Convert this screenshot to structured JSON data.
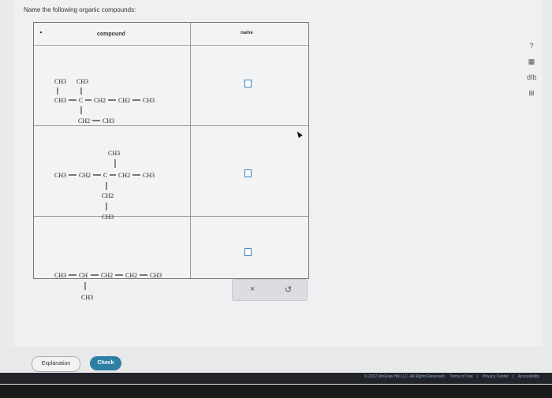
{
  "question": {
    "prompt": "Name the following organic compounds:"
  },
  "table": {
    "headers": {
      "compound": "compound",
      "name": "name"
    },
    "rows": [
      {
        "atoms": [
          "CH3",
          "CH3",
          "CH3",
          "C",
          "CH2",
          "CH2",
          "CH3",
          "CH2",
          "CH3"
        ]
      },
      {
        "atoms": [
          "CH3",
          "CH3",
          "CH2",
          "C",
          "CH2",
          "CH3",
          "CH2",
          "CH3"
        ]
      },
      {
        "atoms": [
          "CH3",
          "CH",
          "CH2",
          "CH2",
          "CH3",
          "CH3"
        ]
      }
    ]
  },
  "actions": {
    "clear": "×",
    "undo": "↺"
  },
  "sidebar_tools": {
    "help": "?",
    "periodic_table": "▦",
    "data": "dIb",
    "calculator": "⊞"
  },
  "buttons": {
    "explanation": "Explanation",
    "check": "Check"
  },
  "footer": {
    "copyright": "© 2022 McGraw Hill LLC. All Rights Reserved.",
    "terms": "Terms of Use",
    "privacy": "Privacy Center",
    "accessibility": "Accessibility"
  },
  "colors": {
    "check_button": "#2d7fa3",
    "answer_box_border": "#3a7fc0",
    "footer_bg": "#22242a"
  }
}
